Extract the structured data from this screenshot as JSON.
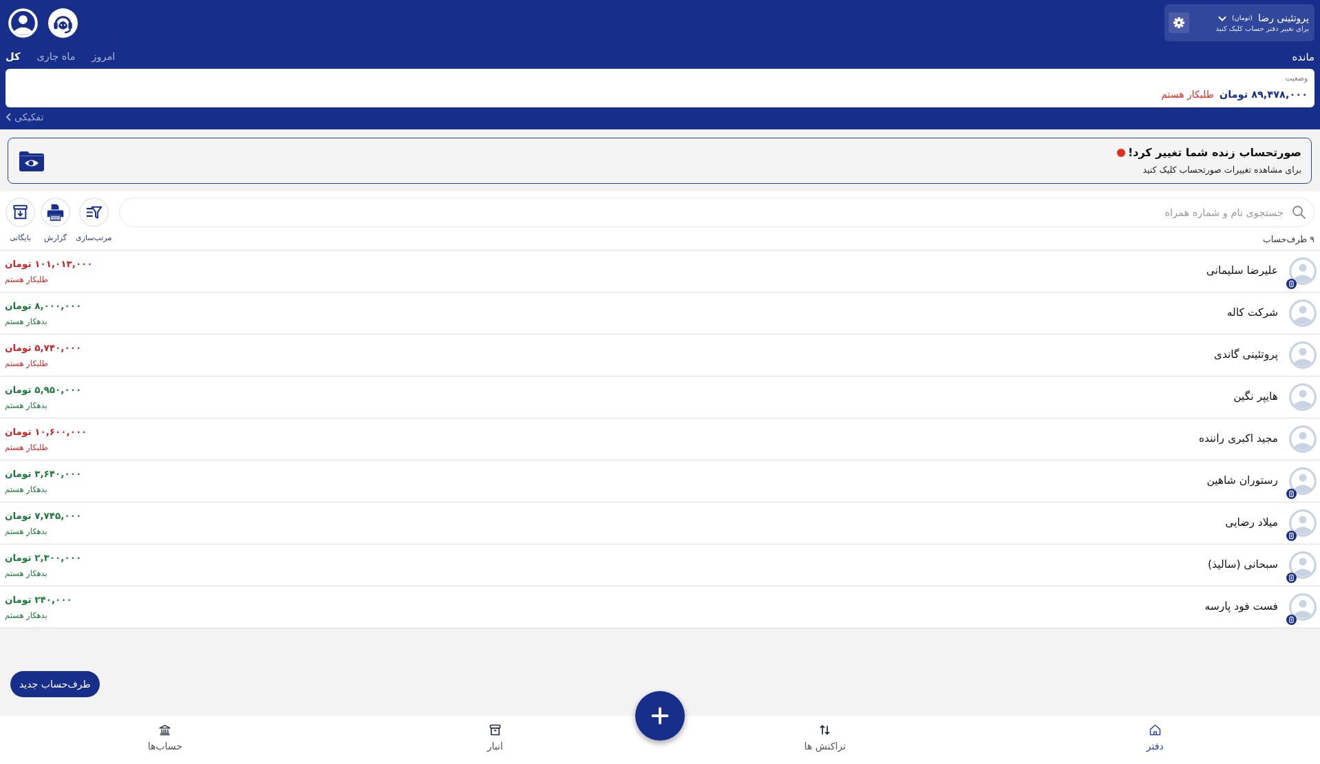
{
  "header": {
    "ledger": {
      "name": "پروتئینی رضا",
      "currency": "(تومان)",
      "hint": "برای تغییر دفتر حساب کلیک کنید"
    },
    "balance_label": "مانده",
    "periods": [
      {
        "label": "امروز",
        "selected": false
      },
      {
        "label": "ماه جاری",
        "selected": false
      },
      {
        "label": "کل",
        "selected": true
      }
    ],
    "balance_card": {
      "caption": "وضعیت",
      "amount": "۸۹,۴۷۸,۰۰۰ تومان",
      "status": "طلبکار هستم"
    },
    "breakdown_link": "تفکیکی"
  },
  "banner": {
    "title": "صورتحساب زنده شما تغییر کرد!",
    "alert": true,
    "subtitle": "برای مشاهده تغییرات صورتحساب کلیک کنید"
  },
  "search": {
    "placeholder": "جستجوی نام و شماره همراه"
  },
  "toolbar": [
    {
      "label": "مرتب‌سازی"
    },
    {
      "label": "گزارش"
    },
    {
      "label": "بایگانی"
    }
  ],
  "contact_count": "۹ طرف‌حساب",
  "contacts": [
    {
      "name": "علیرضا سلیمانی",
      "badge": true,
      "amount": "۱۰۱,۰۱۳,۰۰۰ تومان",
      "status": "طلبکار هستم",
      "color": "#c62828"
    },
    {
      "name": "شرکت کاله",
      "badge": false,
      "amount": "۸,۰۰۰,۰۰۰ تومان",
      "status": "بدهکار هستم",
      "color": "#1b7a3b"
    },
    {
      "name": "پروتئینی گاندی",
      "badge": false,
      "amount": "۵,۷۴۰,۰۰۰ تومان",
      "status": "طلبکار هستم",
      "color": "#c62828"
    },
    {
      "name": "هایپر نگین",
      "badge": false,
      "amount": "۵,۹۵۰,۰۰۰ تومان",
      "status": "بدهکار هستم",
      "color": "#1b7a3b"
    },
    {
      "name": "مجید اکبری راننده",
      "badge": false,
      "amount": "۱۰,۶۰۰,۰۰۰ تومان",
      "status": "طلبکار هستم",
      "color": "#c62828"
    },
    {
      "name": "رستوران شاهین",
      "badge": true,
      "amount": "۳,۶۴۰,۰۰۰ تومان",
      "status": "بدهکار هستم",
      "color": "#1b7a3b"
    },
    {
      "name": "میلاد رضایی",
      "badge": true,
      "amount": "۷,۷۴۵,۰۰۰ تومان",
      "status": "بدهکار هستم",
      "color": "#1b7a3b"
    },
    {
      "name": "سبحانی (سالیذ)",
      "badge": true,
      "amount": "۲,۳۰۰,۰۰۰ تومان",
      "status": "بدهکار هستم",
      "color": "#1b7a3b"
    },
    {
      "name": "فست فود پارسه",
      "badge": true,
      "amount": "۲۴۰,۰۰۰ تومان",
      "status": "بدهکار هستم",
      "color": "#1b7a3b"
    }
  ],
  "new_contact_button": "طرف‌حساب جدید",
  "nav": [
    {
      "label": "دفتر",
      "selected": true
    },
    {
      "label": "تراکنش ها",
      "selected": false
    },
    {
      "label": "انبار",
      "selected": false
    },
    {
      "label": "حساب‌ها",
      "selected": false
    }
  ]
}
